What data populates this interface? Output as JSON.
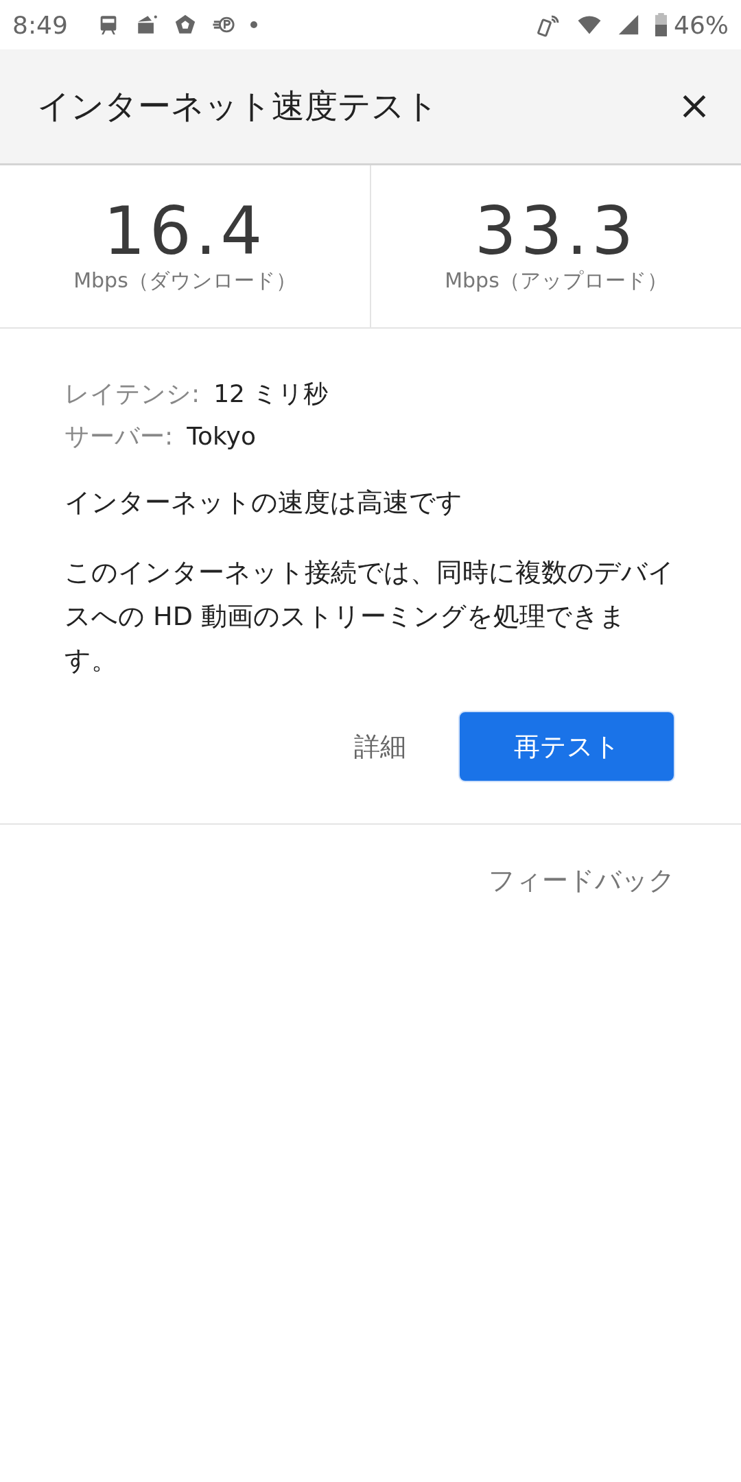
{
  "status_bar": {
    "time": "8:49",
    "battery": "46%"
  },
  "header": {
    "title": "インターネット速度テスト"
  },
  "speeds": [
    {
      "value": "16.4",
      "unit": "Mbps（ダウンロード）"
    },
    {
      "value": "33.3",
      "unit": "Mbps（アップロード）"
    }
  ],
  "details": [
    {
      "label": "レイテンシ:",
      "value": "12 ミリ秒"
    },
    {
      "label": "サーバー:",
      "value": "Tokyo"
    }
  ],
  "result": {
    "heading": "インターネットの速度は高速です",
    "description": "このインターネット接続では、同時に複数のデバイスへの HD 動画のストリーミングを処理できます。"
  },
  "buttons": {
    "details": "詳細",
    "retest": "再テスト"
  },
  "feedback": "フィードバック"
}
